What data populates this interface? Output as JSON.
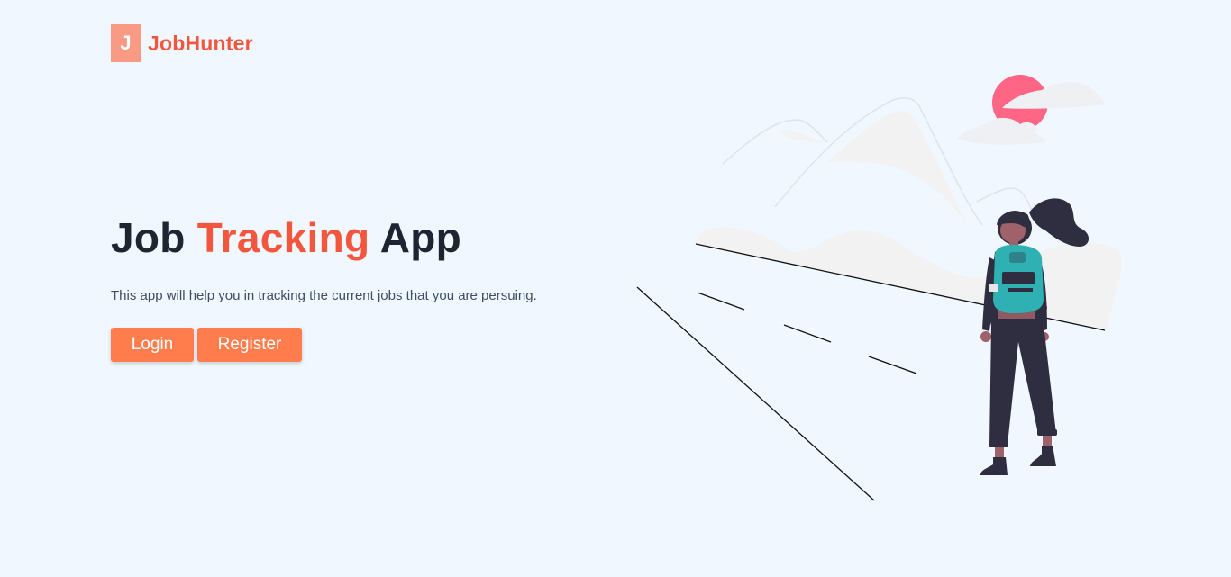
{
  "brand": {
    "mark": "J",
    "name": "JobHunter"
  },
  "hero": {
    "title_part1": "Job",
    "title_accent": "Tracking",
    "title_part2": "App",
    "description": "This app will help you in tracking the current jobs that you are persuing."
  },
  "actions": {
    "login_label": "Login",
    "register_label": "Register"
  },
  "colors": {
    "background": "#f0f7ff",
    "accent": "#f2573d",
    "button": "#ff7d4c",
    "logo_mark": "#f99a84",
    "heading": "#1f2433",
    "sun": "#ff6584",
    "backpack": "#2fb1b3",
    "figure": "#2f2e41"
  },
  "illustration": {
    "icon": "hiker-illustration"
  }
}
